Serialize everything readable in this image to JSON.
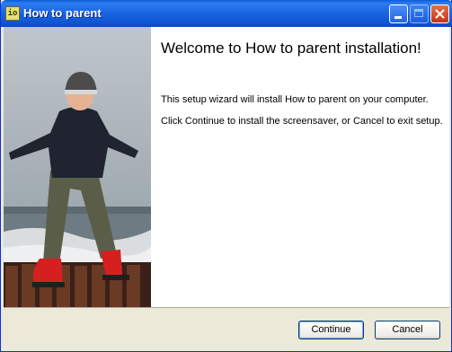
{
  "window": {
    "title": "How to parent",
    "icon": "app-icon"
  },
  "main": {
    "heading": "Welcome to How to parent installation!",
    "paragraph1": "This setup wizard will install How to parent on your computer.",
    "paragraph2": "Click Continue to install the screensaver, or Cancel to exit setup."
  },
  "buttons": {
    "continue_label": "Continue",
    "cancel_label": "Cancel"
  },
  "colors": {
    "titlebar": "#1a64e2",
    "accent": "#003c74"
  }
}
